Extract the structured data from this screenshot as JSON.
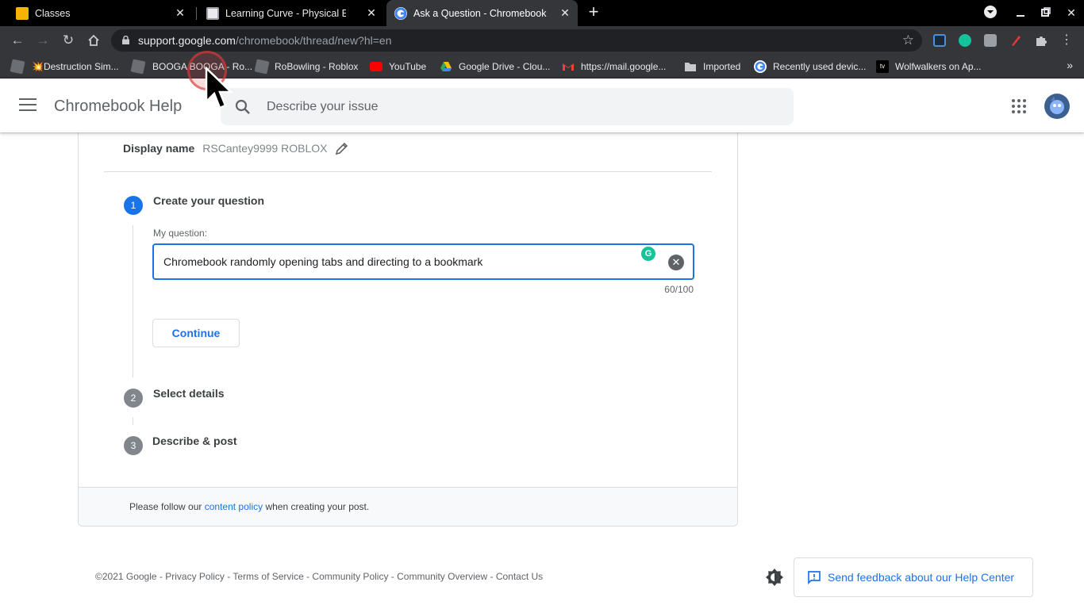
{
  "tabs": [
    {
      "title": "Classes",
      "icon": "classroom-icon",
      "active": false
    },
    {
      "title": "Learning Curve - Physical Educa",
      "icon": "portrait-icon",
      "active": false
    },
    {
      "title": "Ask a Question - Chromebook Co",
      "icon": "google-icon",
      "active": true
    }
  ],
  "address": {
    "host": "support.google.com",
    "path": "/chromebook/thread/new?hl=en"
  },
  "bookmarks": [
    {
      "label": "",
      "icon": "roblox-icon"
    },
    {
      "label": "💥Destruction Sim...",
      "icon": "roblox-icon"
    },
    {
      "label": "BOOGA BOOGA - Ro...",
      "icon": "roblox-icon"
    },
    {
      "label": "RoBowling - Roblox",
      "icon": "roblox-icon"
    },
    {
      "label": "YouTube",
      "icon": "youtube-icon"
    },
    {
      "label": "Google Drive - Clou...",
      "icon": "drive-icon"
    },
    {
      "label": "https://mail.google...",
      "icon": "gmail-icon"
    },
    {
      "label": "Imported",
      "icon": "folder-icon"
    },
    {
      "label": "Recently used devic...",
      "icon": "google-icon"
    },
    {
      "label": "Wolfwalkers on Ap...",
      "icon": "appletv-icon"
    }
  ],
  "header": {
    "title": "Chromebook Help",
    "search_placeholder": "Describe your issue"
  },
  "profile": {
    "display_name_label": "Display name",
    "display_name_value": "RSCantey9999 ROBLOX"
  },
  "steps": [
    {
      "number": "1",
      "title": "Create your question",
      "state": "active"
    },
    {
      "number": "2",
      "title": "Select details",
      "state": "pending"
    },
    {
      "number": "3",
      "title": "Describe & post",
      "state": "pending"
    }
  ],
  "question": {
    "label": "My question:",
    "value": "Chromebook randomly opening tabs and directing to a bookmark",
    "count": "60/100",
    "continue_label": "Continue"
  },
  "policy": {
    "prefix": "Please follow our",
    "link": "content policy",
    "suffix": "when creating your post."
  },
  "footer": {
    "links": [
      "©2021 Google",
      "Privacy Policy",
      "Terms of Service",
      "Community Policy",
      "Community Overview",
      "Contact Us"
    ],
    "feedback_label": "Send feedback about our Help Center"
  },
  "colors": {
    "accent": "#1a73e8",
    "step_pending": "#80868b",
    "chrome_bg": "#35363a"
  }
}
